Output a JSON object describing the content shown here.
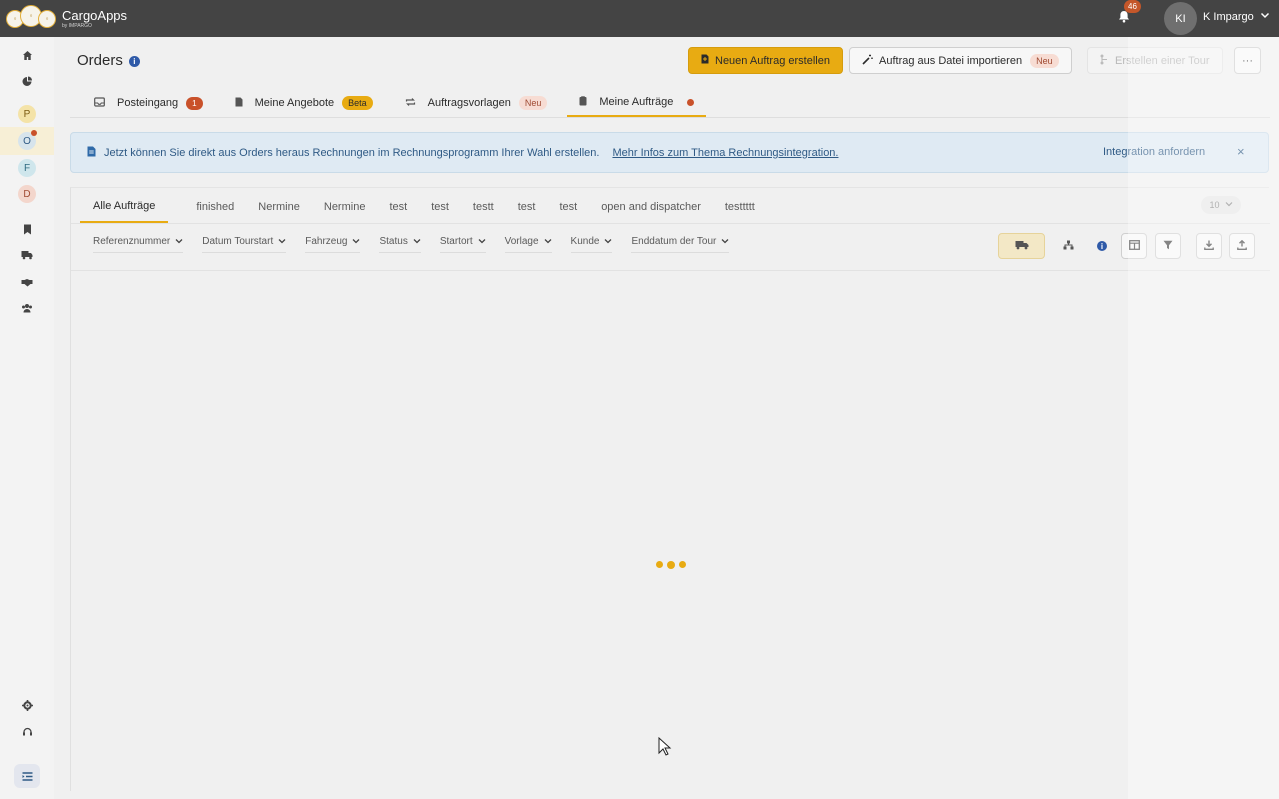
{
  "app": {
    "name": "CargoApps",
    "sub": "by IMPARGO",
    "notifications": "46",
    "user_initials": "KI",
    "user_name": "K Impargo"
  },
  "sidebar": {
    "letters": [
      "P",
      "O",
      "F",
      "D"
    ]
  },
  "header": {
    "title": "Orders",
    "primary_button": "Neuen Auftrag erstellen",
    "import_button": "Auftrag aus Datei importieren",
    "import_badge": "Neu",
    "tour_button": "Erstellen einer Tour",
    "more_button": "···"
  },
  "tabs": [
    {
      "label": "Posteingang",
      "badge": "1"
    },
    {
      "label": "Meine Angebote",
      "badge": "Beta"
    },
    {
      "label": "Auftragsvorlagen",
      "badge": "Neu"
    },
    {
      "label": "Meine Aufträge"
    }
  ],
  "banner": {
    "text": "Jetzt können Sie direkt aus Orders heraus Rechnungen im Rechnungsprogramm Ihrer Wahl erstellen.",
    "link": "Mehr Infos zum Thema Rechnungsintegration.",
    "cta": "Integration anfordern",
    "close": "×"
  },
  "views": [
    "Alle Aufträge",
    "finished",
    "Nermine",
    "Nermine",
    "test",
    "test",
    "testt",
    "test",
    "test",
    "open and dispatcher",
    "testtttt"
  ],
  "page_size": "10",
  "filters": [
    "Referenznummer",
    "Datum Tourstart",
    "Fahrzeug",
    "Status",
    "Startort",
    "Vorlage",
    "Kunde",
    "Enddatum der Tour"
  ],
  "colors": {
    "accent": "#e8ab12",
    "topbar": "#444444",
    "alert": "#c9512a",
    "info_bg": "#dfeaf3"
  },
  "icons": {
    "tools": [
      "truck-icon",
      "network-icon",
      "info-icon",
      "columns-icon",
      "filter-icon",
      "download-icon",
      "upload-icon"
    ]
  }
}
